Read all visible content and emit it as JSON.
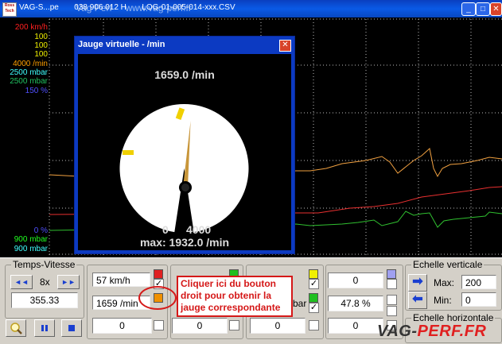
{
  "window": {
    "title": "VAG-S...pe       038 906 012 H       LOG-01-005-014-xxx.CSV",
    "watermark": "Vag Perf     www.vag-perf.fr",
    "icon_label": "Ross Tech"
  },
  "chart": {
    "axis_labels": [
      {
        "text": "200 km/h",
        "color": "#ff2020"
      },
      {
        "text": "100",
        "color": "#f0f000"
      },
      {
        "text": "100",
        "color": "#f0f000"
      },
      {
        "text": "100",
        "color": "#f0f000"
      },
      {
        "text": "4000 /min",
        "color": "#ffa000"
      },
      {
        "text": "2500 mbar",
        "color": "#40ffff"
      },
      {
        "text": "2500 mbar",
        "color": "#20c060"
      },
      {
        "text": "150 %",
        "color": "#5050ff"
      },
      {
        "text": "0 %",
        "color": "#5050ff"
      },
      {
        "text": "900 mbar",
        "color": "#20ff20"
      },
      {
        "text": "900 mbar",
        "color": "#40ffff"
      }
    ],
    "series_colors": {
      "rpm": "#f0a040",
      "speed": "#e83030",
      "boost": "#30c030"
    }
  },
  "gauge": {
    "title": "Jauge virtuelle - /min",
    "value": "1659.0 /min",
    "scale_min": "0",
    "scale_max": "4000",
    "peak": "max: 1932.0 /min",
    "needle_fraction": 0.415
  },
  "panel": {
    "time_speed": {
      "title": "Temps-Vitesse",
      "speed": "8x",
      "time": "355.33",
      "rewind": "◄◄",
      "forward": "►►"
    },
    "channels": [
      {
        "value": "57 km/h",
        "color": "#e02020",
        "checked": true
      },
      {
        "value": "1659 /min",
        "color": "#f09000",
        "checked": false
      },
      {
        "value": "0",
        "color": "#d4d0c8",
        "checked": false
      },
      {
        "value": "",
        "color": "#20c020",
        "checked": false
      },
      {
        "value": "",
        "color": "#d4d0c8",
        "checked": false
      },
      {
        "value": "0",
        "color": "#d4d0c8",
        "checked": false
      },
      {
        "value": "",
        "color": "#f0f000",
        "checked": true
      },
      {
        "value": "bar",
        "color": "#20c020",
        "checked": true
      },
      {
        "value": "0",
        "color": "#d4d0c8",
        "checked": false
      },
      {
        "value": "0",
        "color": "#a0a0f0",
        "checked": false
      },
      {
        "value": "47.8 %",
        "color": "#d4d0c8",
        "checked": false
      },
      {
        "value": "0",
        "color": "#d4d0c8",
        "checked": false
      }
    ],
    "vscale": {
      "title": "Echelle verticale",
      "max_label": "Max:",
      "max_value": "200",
      "min_label": "Min:",
      "min_value": "0"
    },
    "hscale": {
      "title": "Echelle horizontale"
    }
  },
  "annotation": {
    "text": "Cliquer ici du bouton droit pour obtenir la jauge correspondante"
  },
  "branding": {
    "logo_main": "VAG-",
    "logo_accent": "PERF.FR"
  }
}
